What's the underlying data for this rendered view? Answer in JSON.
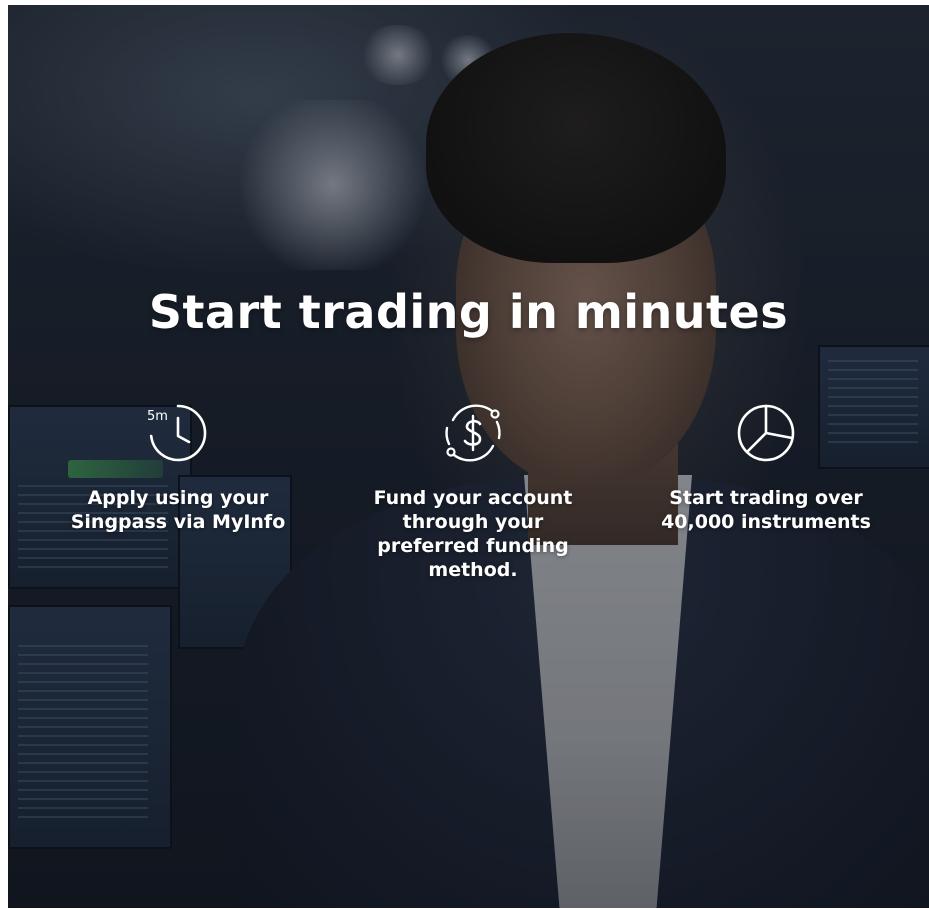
{
  "hero": {
    "title": "Start trading in minutes"
  },
  "features": [
    {
      "icon": "clock-5m-icon",
      "icon_badge": "5m",
      "text": "Apply using your Singpass via MyInfo"
    },
    {
      "icon": "dollar-cycle-icon",
      "text": "Fund your account through your preferred funding method."
    },
    {
      "icon": "pie-chart-icon",
      "text": "Start trading over 40,000 instruments"
    }
  ],
  "colors": {
    "text": "#ffffff",
    "overlay": "#0c1018"
  }
}
